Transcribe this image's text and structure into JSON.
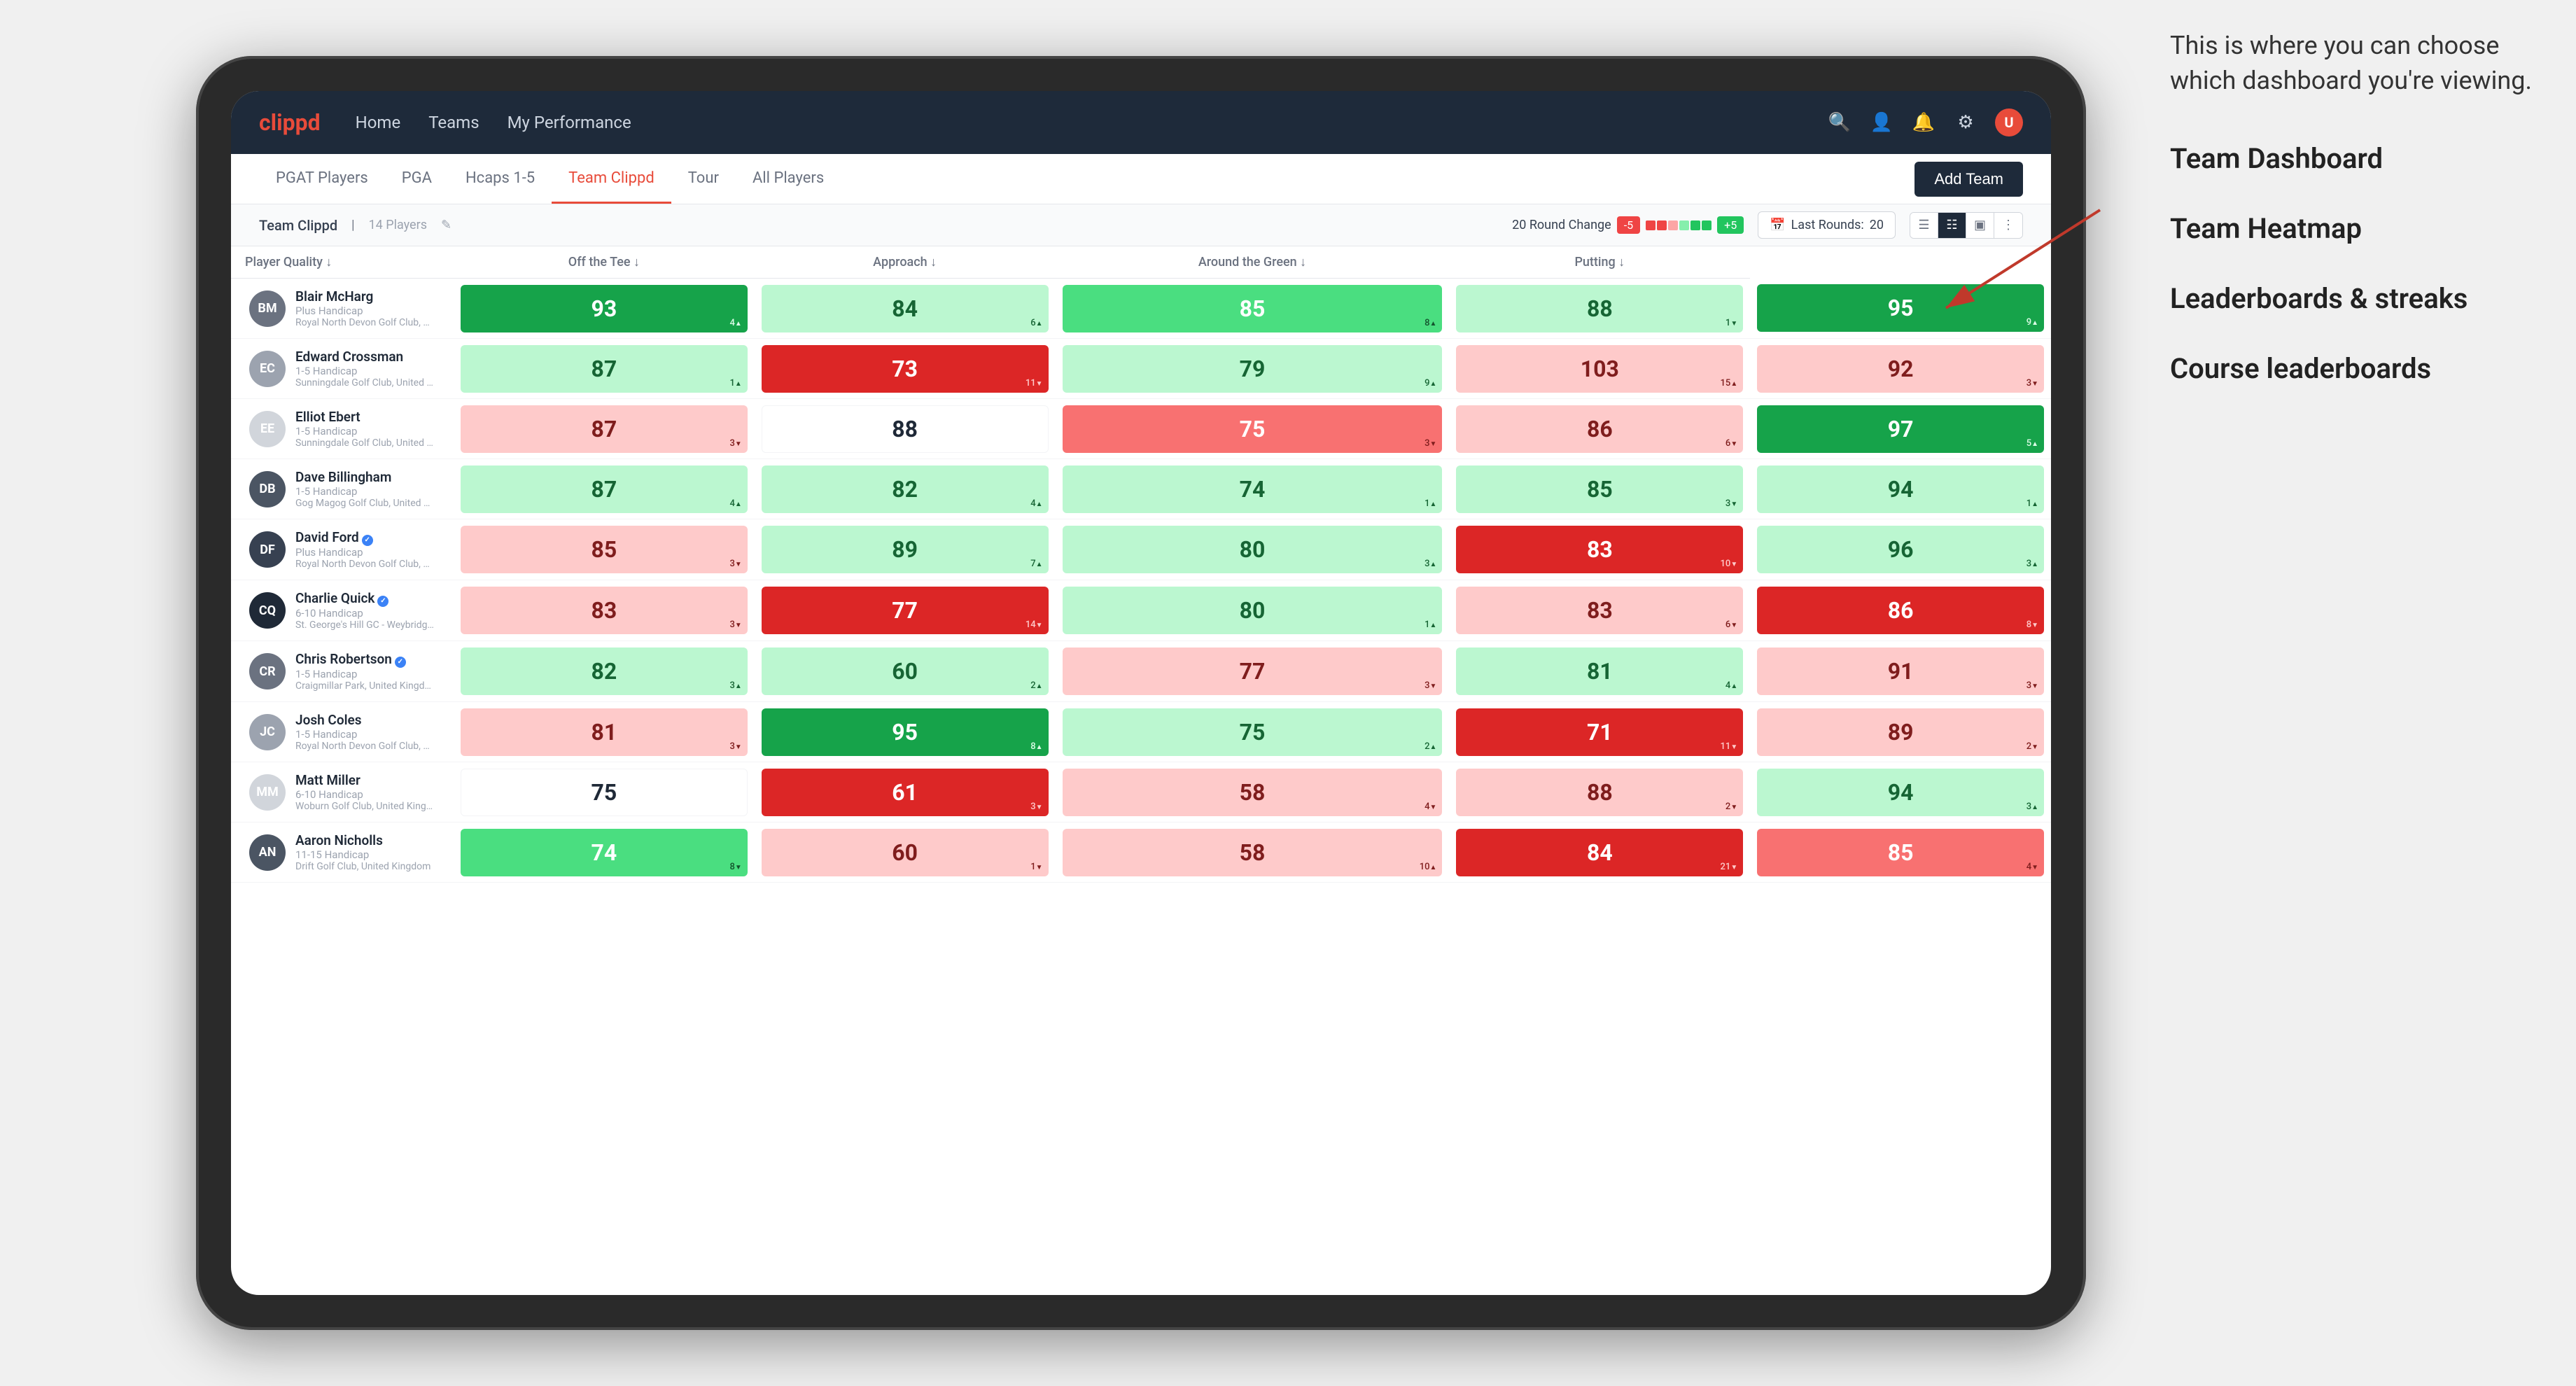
{
  "annotation": {
    "bubble_text": "This is where you can choose which dashboard you're viewing.",
    "list_items": [
      "Team Dashboard",
      "Team Heatmap",
      "Leaderboards & streaks",
      "Course leaderboards"
    ]
  },
  "nav": {
    "logo": "clippd",
    "links": [
      "Home",
      "Teams",
      "My Performance"
    ],
    "icons": [
      "search",
      "person",
      "bell",
      "settings",
      "avatar"
    ]
  },
  "tabs": {
    "items": [
      "PGAT Players",
      "PGA",
      "Hcaps 1-5",
      "Team Clippd",
      "Tour",
      "All Players"
    ],
    "active": "Team Clippd",
    "add_button": "Add Team"
  },
  "sub_header": {
    "team_name": "Team Clippd",
    "count": "14 Players",
    "round_change_label": "20 Round Change",
    "neg_badge": "-5",
    "pos_badge": "+5",
    "last_rounds_label": "Last Rounds:",
    "last_rounds_value": "20"
  },
  "table": {
    "columns": [
      "Player Quality ↓",
      "Off the Tee ↓",
      "Approach ↓",
      "Around the Green ↓",
      "Putting ↓"
    ],
    "rows": [
      {
        "name": "Blair McHarg",
        "hcap": "Plus Handicap",
        "club": "Royal North Devon Golf Club, United Kingdom",
        "scores": [
          {
            "value": "93",
            "change": "4",
            "dir": "up",
            "color": "green-dark"
          },
          {
            "value": "84",
            "change": "6",
            "dir": "up",
            "color": "green-light"
          },
          {
            "value": "85",
            "change": "8",
            "dir": "up",
            "color": "green-med"
          },
          {
            "value": "88",
            "change": "1",
            "dir": "down",
            "color": "green-light"
          },
          {
            "value": "95",
            "change": "9",
            "dir": "up",
            "color": "green-dark"
          }
        ]
      },
      {
        "name": "Edward Crossman",
        "hcap": "1-5 Handicap",
        "club": "Sunningdale Golf Club, United Kingdom",
        "scores": [
          {
            "value": "87",
            "change": "1",
            "dir": "up",
            "color": "green-light"
          },
          {
            "value": "73",
            "change": "11",
            "dir": "down",
            "color": "red-dark"
          },
          {
            "value": "79",
            "change": "9",
            "dir": "up",
            "color": "green-light"
          },
          {
            "value": "103",
            "change": "15",
            "dir": "up",
            "color": "red-light"
          },
          {
            "value": "92",
            "change": "3",
            "dir": "down",
            "color": "red-light"
          }
        ]
      },
      {
        "name": "Elliot Ebert",
        "hcap": "1-5 Handicap",
        "club": "Sunningdale Golf Club, United Kingdom",
        "scores": [
          {
            "value": "87",
            "change": "3",
            "dir": "down",
            "color": "red-light"
          },
          {
            "value": "88",
            "change": "",
            "dir": "",
            "color": "white"
          },
          {
            "value": "75",
            "change": "3",
            "dir": "down",
            "color": "red-med"
          },
          {
            "value": "86",
            "change": "6",
            "dir": "down",
            "color": "red-light"
          },
          {
            "value": "97",
            "change": "5",
            "dir": "up",
            "color": "green-dark"
          }
        ]
      },
      {
        "name": "Dave Billingham",
        "hcap": "1-5 Handicap",
        "club": "Gog Magog Golf Club, United Kingdom",
        "scores": [
          {
            "value": "87",
            "change": "4",
            "dir": "up",
            "color": "green-light"
          },
          {
            "value": "82",
            "change": "4",
            "dir": "up",
            "color": "green-light"
          },
          {
            "value": "74",
            "change": "1",
            "dir": "up",
            "color": "green-light"
          },
          {
            "value": "85",
            "change": "3",
            "dir": "down",
            "color": "green-light"
          },
          {
            "value": "94",
            "change": "1",
            "dir": "up",
            "color": "green-light"
          }
        ]
      },
      {
        "name": "David Ford",
        "hcap": "Plus Handicap",
        "club": "Royal North Devon Golf Club, United Kingdom",
        "verified": true,
        "scores": [
          {
            "value": "85",
            "change": "3",
            "dir": "down",
            "color": "red-light"
          },
          {
            "value": "89",
            "change": "7",
            "dir": "up",
            "color": "green-light"
          },
          {
            "value": "80",
            "change": "3",
            "dir": "up",
            "color": "green-light"
          },
          {
            "value": "83",
            "change": "10",
            "dir": "down",
            "color": "red-dark"
          },
          {
            "value": "96",
            "change": "3",
            "dir": "up",
            "color": "green-light"
          }
        ]
      },
      {
        "name": "Charlie Quick",
        "hcap": "6-10 Handicap",
        "club": "St. George's Hill GC - Weybridge - Surrey, Uni...",
        "verified": true,
        "scores": [
          {
            "value": "83",
            "change": "3",
            "dir": "down",
            "color": "red-light"
          },
          {
            "value": "77",
            "change": "14",
            "dir": "down",
            "color": "red-dark"
          },
          {
            "value": "80",
            "change": "1",
            "dir": "up",
            "color": "green-light"
          },
          {
            "value": "83",
            "change": "6",
            "dir": "down",
            "color": "red-light"
          },
          {
            "value": "86",
            "change": "8",
            "dir": "down",
            "color": "red-dark"
          }
        ]
      },
      {
        "name": "Chris Robertson",
        "hcap": "1-5 Handicap",
        "club": "Craigmillar Park, United Kingdom",
        "verified": true,
        "scores": [
          {
            "value": "82",
            "change": "3",
            "dir": "up",
            "color": "green-light"
          },
          {
            "value": "60",
            "change": "2",
            "dir": "up",
            "color": "green-light"
          },
          {
            "value": "77",
            "change": "3",
            "dir": "down",
            "color": "red-light"
          },
          {
            "value": "81",
            "change": "4",
            "dir": "up",
            "color": "green-light"
          },
          {
            "value": "91",
            "change": "3",
            "dir": "down",
            "color": "red-light"
          }
        ]
      },
      {
        "name": "Josh Coles",
        "hcap": "1-5 Handicap",
        "club": "Royal North Devon Golf Club, United Kingdom",
        "scores": [
          {
            "value": "81",
            "change": "3",
            "dir": "down",
            "color": "red-light"
          },
          {
            "value": "95",
            "change": "8",
            "dir": "up",
            "color": "green-dark"
          },
          {
            "value": "75",
            "change": "2",
            "dir": "up",
            "color": "green-light"
          },
          {
            "value": "71",
            "change": "11",
            "dir": "down",
            "color": "red-dark"
          },
          {
            "value": "89",
            "change": "2",
            "dir": "down",
            "color": "red-light"
          }
        ]
      },
      {
        "name": "Matt Miller",
        "hcap": "6-10 Handicap",
        "club": "Woburn Golf Club, United Kingdom",
        "scores": [
          {
            "value": "75",
            "change": "",
            "dir": "",
            "color": "white"
          },
          {
            "value": "61",
            "change": "3",
            "dir": "down",
            "color": "red-dark"
          },
          {
            "value": "58",
            "change": "4",
            "dir": "down",
            "color": "red-light"
          },
          {
            "value": "88",
            "change": "2",
            "dir": "down",
            "color": "red-light"
          },
          {
            "value": "94",
            "change": "3",
            "dir": "up",
            "color": "green-light"
          }
        ]
      },
      {
        "name": "Aaron Nicholls",
        "hcap": "11-15 Handicap",
        "club": "Drift Golf Club, United Kingdom",
        "scores": [
          {
            "value": "74",
            "change": "8",
            "dir": "down",
            "color": "green-med"
          },
          {
            "value": "60",
            "change": "1",
            "dir": "down",
            "color": "red-light"
          },
          {
            "value": "58",
            "change": "10",
            "dir": "up",
            "color": "red-light"
          },
          {
            "value": "84",
            "change": "21",
            "dir": "down",
            "color": "red-dark"
          },
          {
            "value": "85",
            "change": "4",
            "dir": "down",
            "color": "red-med"
          }
        ]
      }
    ]
  }
}
